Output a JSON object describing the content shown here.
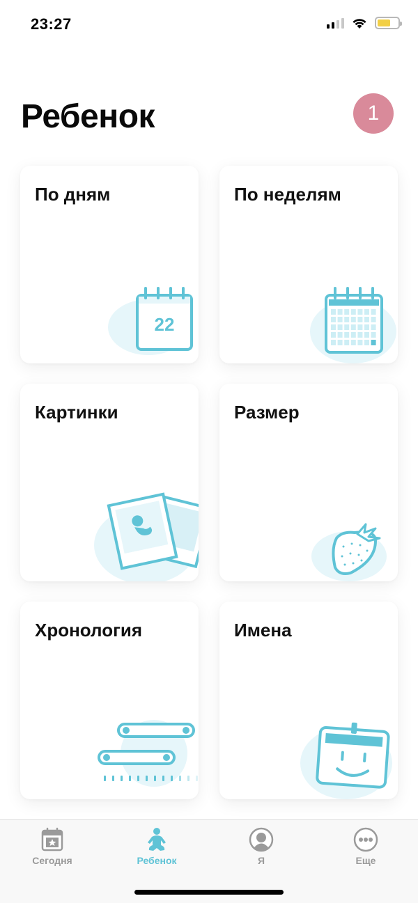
{
  "status_bar": {
    "time": "23:27"
  },
  "header": {
    "title": "Ребенок",
    "badge": "1"
  },
  "cards": {
    "days": {
      "title": "По дням",
      "calendar_day": "22"
    },
    "weeks": {
      "title": "По неделям"
    },
    "pictures": {
      "title": "Картинки"
    },
    "size": {
      "title": "Размер"
    },
    "timeline": {
      "title": "Хронология"
    },
    "names": {
      "title": "Имена"
    }
  },
  "tab_bar": {
    "today": "Сегодня",
    "child": "Ребенок",
    "me": "Я",
    "more": "Еще"
  },
  "colors": {
    "accent": "#5fc3d6",
    "accent_light": "#e6f6fa",
    "badge": "#d98a9a",
    "inactive": "#9a9a9a",
    "battery": "#f2cf45"
  }
}
